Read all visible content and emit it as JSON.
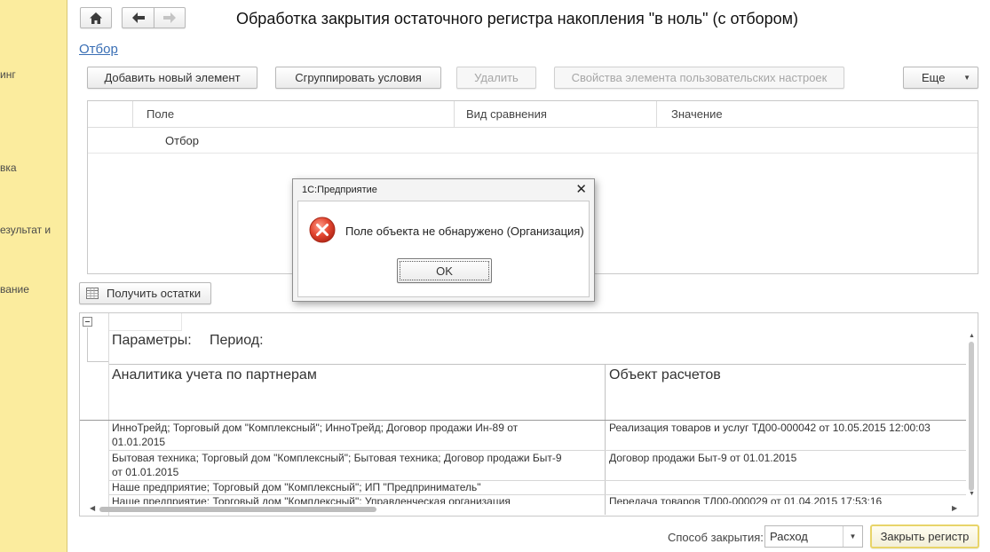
{
  "sidebar": {
    "items": [
      "инг",
      "вка",
      "езультат и",
      "вание"
    ]
  },
  "nav": {
    "home_icon": "home-icon",
    "back_icon": "arrow-left-icon",
    "forward_icon": "arrow-right-icon"
  },
  "title": "Обработка закрытия остаточного регистра накопления \"в ноль\" (с отбором)",
  "filter_link": "Отбор",
  "toolbar": {
    "add": "Добавить новый элемент",
    "group": "Сгруппировать условия",
    "delete": "Удалить",
    "properties": "Свойства элемента пользовательских настроек",
    "more": "Еще"
  },
  "filter_table": {
    "columns": [
      "Поле",
      "Вид сравнения",
      "Значение"
    ],
    "rows": [
      "Отбор"
    ]
  },
  "get_balances": "Получить остатки",
  "report": {
    "params_label": "Параметры:",
    "period_label": "Период:",
    "col1": "Аналитика учета по партнерам",
    "col2": "Объект расчетов",
    "rows": [
      {
        "a1": "ИнноТрейд; Торговый дом \"Комплексный\"; ИнноТрейд; Договор продажи Ин-89 от",
        "a2": "01.01.2015",
        "b": "Реализация товаров и услуг ТД00-000042 от 10.05.2015 12:00:03"
      },
      {
        "a1": "Бытовая техника; Торговый дом \"Комплексный\"; Бытовая техника; Договор продажи Быт-9",
        "a2": "от 01.01.2015",
        "b": "Договор продажи Быт-9 от 01.01.2015"
      },
      {
        "a1": "Наше предприятие; Торговый дом \"Комплексный\"; ИП \"Предприниматель\"",
        "a2": "",
        "b": ""
      },
      {
        "a1": "Наше предприятие; Торговый дом \"Комплексный\"; Управленческая организация",
        "a2": "",
        "b": "Передача товаров ТД00-000029 от 01.04.2015 17:53:16"
      }
    ]
  },
  "footer": {
    "method_label": "Способ закрытия:",
    "method_value": "Расход",
    "close_button": "Закрыть регистр"
  },
  "dialog": {
    "title": "1С:Предприятие",
    "message": "Поле объекта не обнаружено (Организация)",
    "ok": "OK"
  }
}
